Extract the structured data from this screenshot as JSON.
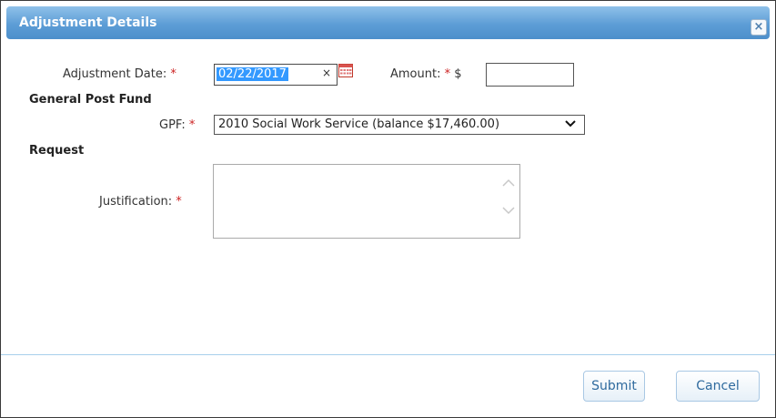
{
  "dialog": {
    "title": "Adjustment Details",
    "close_glyph": "×"
  },
  "form": {
    "adjustment_date": {
      "label": "Adjustment Date:",
      "required_mark": "*",
      "value": "02/22/2017",
      "clear_glyph": "×"
    },
    "amount": {
      "label": "Amount:",
      "required_mark": "*",
      "currency_symbol": "$",
      "value": ""
    },
    "general_post_fund": {
      "section_title": "General Post Fund"
    },
    "gpf": {
      "label": "GPF:",
      "required_mark": "*",
      "selected": "2010 Social Work Service (balance $17,460.00)"
    },
    "request": {
      "section_title": "Request"
    },
    "justification": {
      "label": "Justification:",
      "required_mark": "*",
      "value": ""
    }
  },
  "footer": {
    "submit_label": "Submit",
    "cancel_label": "Cancel"
  },
  "colors": {
    "titlebar": "#5d9dd6",
    "required": "#cc2222",
    "selection": "#3399ff",
    "button_text": "#2f6a9e"
  },
  "icons": {
    "close": "close-icon",
    "calendar": "calendar-icon",
    "dropdown": "chevron-down-icon",
    "scroll_up": "chevron-up-icon",
    "scroll_down": "chevron-down-icon"
  }
}
